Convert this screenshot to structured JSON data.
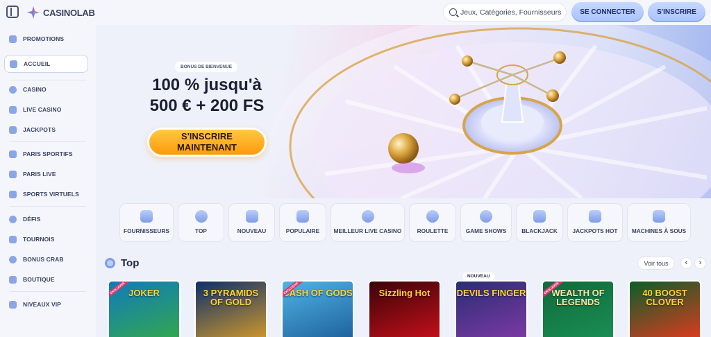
{
  "header": {
    "logo_text": "CASINOLAB",
    "search_placeholder": "Jeux, Catégories, Fournisseurs",
    "login_label": "SE CONNECTER",
    "signup_label": "S'INSCRIRE"
  },
  "sidebar": {
    "items": [
      {
        "label": "PROMOTIONS",
        "icon": "promotions-icon"
      },
      {
        "label": "ACCUEIL",
        "icon": "home-icon",
        "active": true
      },
      {
        "label": "CASINO",
        "icon": "casino-chip-icon"
      },
      {
        "label": "LIVE CASINO",
        "icon": "live-casino-icon"
      },
      {
        "label": "JACKPOTS",
        "icon": "jackpots-icon"
      },
      {
        "label": "PARIS SPORTIFS",
        "icon": "sports-betting-icon"
      },
      {
        "label": "PARIS LIVE",
        "icon": "live-betting-icon"
      },
      {
        "label": "SPORTS VIRTUELS",
        "icon": "virtual-sports-icon"
      },
      {
        "label": "DÉFIS",
        "icon": "challenges-icon"
      },
      {
        "label": "TOURNOIS",
        "icon": "trophy-icon"
      },
      {
        "label": "BONUS CRAB",
        "icon": "bonus-crab-icon"
      },
      {
        "label": "BOUTIQUE",
        "icon": "shop-icon"
      },
      {
        "label": "NIVEAUX VIP",
        "icon": "vip-icon"
      }
    ]
  },
  "hero": {
    "badge": "BONUS DE BIENVENUE",
    "title_line1": "100 % jusqu'à",
    "title_line2": "500 € + 200 FS",
    "cta_line1": "S'INSCRIRE",
    "cta_line2": "MAINTENANT"
  },
  "categories": [
    {
      "label": "FOURNISSEURS",
      "icon": "providers-icon"
    },
    {
      "label": "TOP",
      "icon": "top-gear-icon"
    },
    {
      "label": "NOUVEAU",
      "icon": "new-icon"
    },
    {
      "label": "POPULAIRE",
      "icon": "star-icon"
    },
    {
      "label": "MEILLEUR LIVE CASINO",
      "icon": "live-star-icon"
    },
    {
      "label": "ROULETTE",
      "icon": "roulette-icon"
    },
    {
      "label": "GAME SHOWS",
      "icon": "game-shows-icon"
    },
    {
      "label": "BLACKJACK",
      "icon": "cards-icon"
    },
    {
      "label": "JACKPOTS HOT",
      "icon": "hot-jackpot-icon"
    },
    {
      "label": "MACHINES À SOUS",
      "icon": "slot-machine-icon"
    }
  ],
  "top_section": {
    "title": "Top",
    "see_all": "Voir tous",
    "prev": "‹",
    "next": "›",
    "new_tag": "NOUVEAU"
  },
  "games": [
    {
      "name": "JOKER",
      "ribbon": "EXCLUSIVE",
      "colors": [
        "#0f7bbd",
        "#34a84a"
      ]
    },
    {
      "name": "3 PYRAMIDS OF GOLD",
      "ribbon": "",
      "colors": [
        "#0c2f6b",
        "#d39a2a"
      ]
    },
    {
      "name": "CASH OF GODS",
      "ribbon": "EXCLUSIVE",
      "colors": [
        "#4fb4e6",
        "#1d5f9a"
      ]
    },
    {
      "name": "Sizzling Hot",
      "ribbon": "",
      "colors": [
        "#3a0408",
        "#c8101a"
      ]
    },
    {
      "name": "DEVILS FINGER",
      "ribbon": "",
      "colors": [
        "#2a2d74",
        "#7e3aa6"
      ]
    },
    {
      "name": "WEALTH OF LEGENDS",
      "ribbon": "EXCLUSIVE",
      "colors": [
        "#0f6b3a",
        "#1b8f55"
      ]
    },
    {
      "name": "40 BOOST CLOVER",
      "ribbon": "",
      "colors": [
        "#0b5d2a",
        "#e23a1e"
      ]
    }
  ]
}
